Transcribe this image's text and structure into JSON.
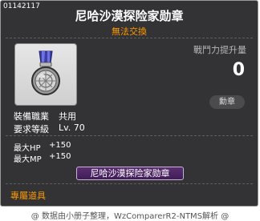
{
  "item": {
    "id": "01142117",
    "name": "尼哈沙漠探险家勋章",
    "trade_status": "無法交換",
    "icon": "medal-icon"
  },
  "power": {
    "label": "戰鬥力提升量",
    "value": "0"
  },
  "badge": {
    "label": "勳章"
  },
  "requirements": {
    "job_label": "裝備職業",
    "job_value": "共用",
    "level_label": "要求等級",
    "level_value": "Lv. 70"
  },
  "stats": [
    {
      "label": "最大HP",
      "value": "+150"
    },
    {
      "label": "最大MP",
      "value": "+150"
    }
  ],
  "medal_button": {
    "label": "尼哈沙漠探险家勋章"
  },
  "exclusive_label": "專屬道具",
  "footer": "@ 数据由小册子整理，WzComparerR2-NTMS解析 @",
  "colors": {
    "background": "#333335",
    "accent": "#ff9900",
    "medal_button": "#4f2766"
  }
}
